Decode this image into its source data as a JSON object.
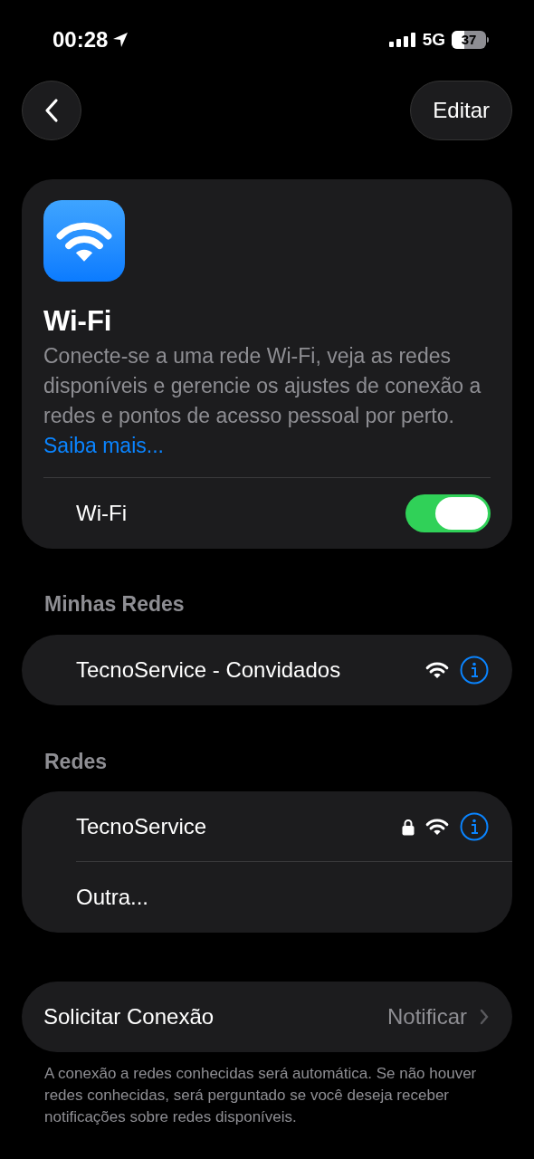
{
  "status_bar": {
    "time": "00:28",
    "network": "5G",
    "battery": "37"
  },
  "nav": {
    "edit_button": "Editar"
  },
  "header": {
    "title": "Wi-Fi",
    "description": "Conecte-se a uma rede Wi-Fi, veja as redes disponíveis e gerencie os ajustes de conexão a redes e pontos de acesso pessoal por perto.",
    "link": "Saiba mais..."
  },
  "wifi_toggle": {
    "label": "Wi-Fi",
    "on": true
  },
  "my_networks": {
    "title": "Minhas Redes",
    "items": [
      {
        "kind": "network",
        "name": "TecnoService - Convidados",
        "secured": false
      }
    ]
  },
  "networks": {
    "title": "Redes",
    "items": [
      {
        "kind": "network",
        "name": "TecnoService",
        "secured": true
      },
      {
        "kind": "other",
        "name": "Outra..."
      }
    ]
  },
  "ask_to_join": {
    "label": "Solicitar Conexão",
    "value": "Notificar",
    "footer": "A conexão a redes conhecidas será automática. Se não houver redes conhecidas, será perguntado se você deseja receber notificações sobre redes disponíveis."
  }
}
